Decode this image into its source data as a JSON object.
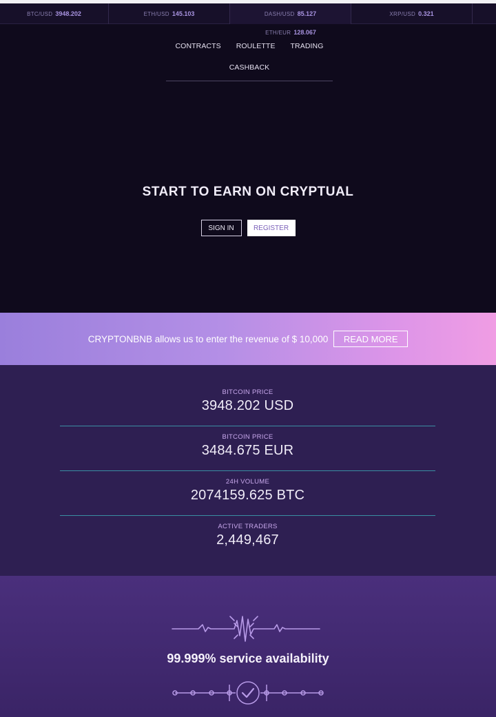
{
  "ticker": [
    {
      "pair": "BTC/USD",
      "value": "3948.202"
    },
    {
      "pair": "ETH/USD",
      "value": "145.103"
    },
    {
      "pair": "DASH/USD",
      "value": "85.127"
    },
    {
      "pair": "XRP/USD",
      "value": "0.321"
    },
    {
      "pair": "ETH/EUR",
      "value": "128.067"
    }
  ],
  "nav": {
    "items": [
      "CONTRACTS",
      "ROULETTE",
      "TRADING",
      "CASHBACK"
    ]
  },
  "hero": {
    "title": "START TO EARN ON CRYPTUAL",
    "sign_in": "SIGN IN",
    "register": "REGISTER"
  },
  "promo": {
    "text": "CRYPTONBNB allows us to enter the revenue of $ 10,000",
    "button": "READ MORE"
  },
  "stats": [
    {
      "label": "BITCOIN PRICE",
      "value": "3948.202 USD"
    },
    {
      "label": "BITCOIN PRICE",
      "value": "3484.675 EUR"
    },
    {
      "label": "24H VOLUME",
      "value": "2074159.625 BTC"
    },
    {
      "label": "ACTIVE TRADERS",
      "value": "2,449,467"
    }
  ],
  "availability": {
    "title": "99.999% service availability",
    "pulse_icon": "heartbeat-line-icon",
    "check_icon": "check-circle-icon"
  },
  "colors": {
    "background": "#0f0a1c",
    "accent": "#a893e0",
    "stats_bg": "#2e1f52",
    "divider": "#3a8fa3"
  }
}
